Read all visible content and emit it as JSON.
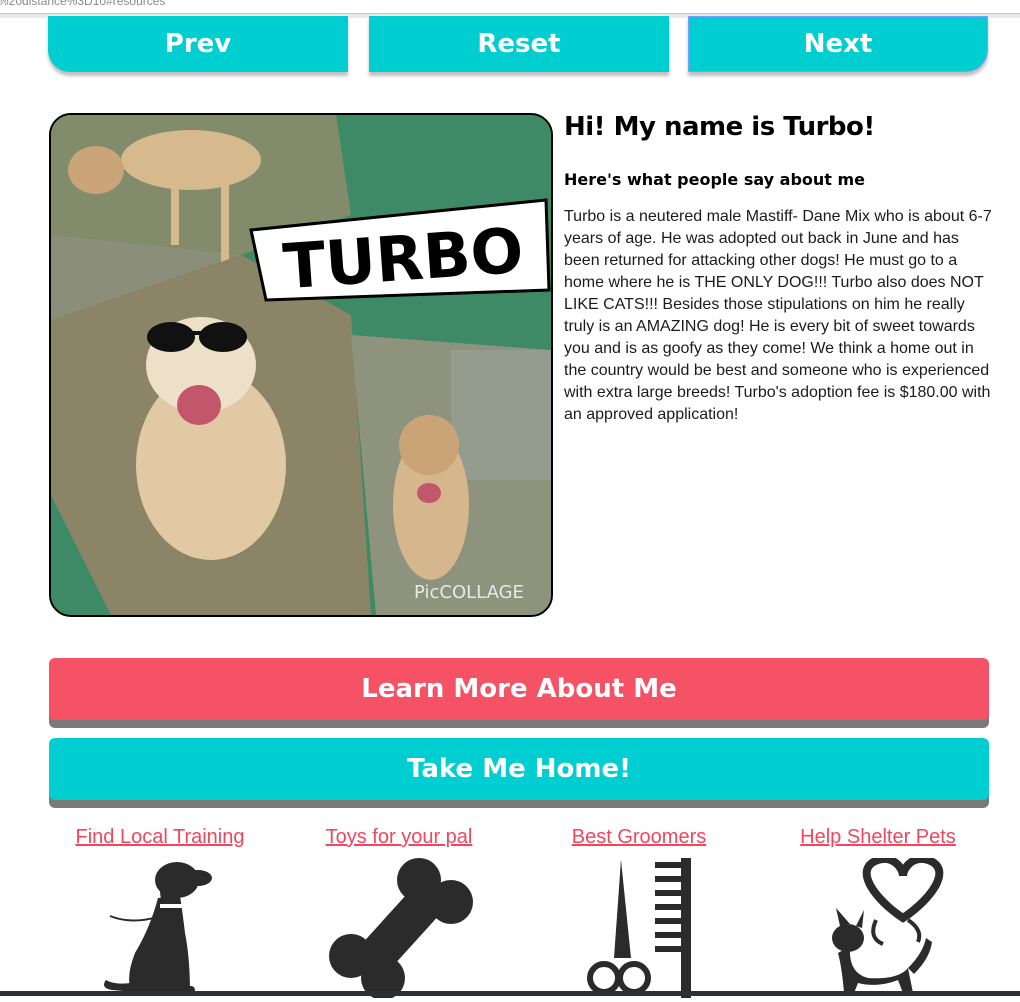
{
  "browser": {
    "url_fragment": "%20distance%3D10#resources"
  },
  "nav": {
    "prev_label": "Prev",
    "reset_label": "Reset",
    "next_label": "Next"
  },
  "pet": {
    "photo_overlay_text": "TURBO",
    "photo_watermark": "PicCOLLAGE",
    "heading": "Hi! My name is Turbo!",
    "subheading": "Here's what people say about me",
    "bio": "Turbo is a neutered male Mastiff- Dane Mix who is about 6-7 years of age. He was adopted out back in June and has been returned for attacking other dogs! He must go to a home where he is THE ONLY DOG!!! Turbo also does NOT LIKE CATS!!! Besides those stipulations on him he really truly is an AMAZING dog! He is every bit of sweet towards you and is as goofy as they come! We think a home out in the country would be best and someone who is experienced with extra large breeds! Turbo's adoption fee is $180.00 with an approved application!"
  },
  "actions": {
    "learn_more_label": "Learn More About Me",
    "take_home_label": "Take Me Home!"
  },
  "resources": [
    {
      "label": "Find Local Training",
      "icon": "sitting-dog-icon"
    },
    {
      "label": "Toys for your pal",
      "icon": "bone-icon"
    },
    {
      "label": "Best Groomers",
      "icon": "scissors-comb-icon"
    },
    {
      "label": "Help Shelter Pets",
      "icon": "dog-heart-icon"
    }
  ],
  "colors": {
    "teal": "#00ced1",
    "coral": "#f55266",
    "link": "#f0465e",
    "icon": "#2b2b2b"
  }
}
